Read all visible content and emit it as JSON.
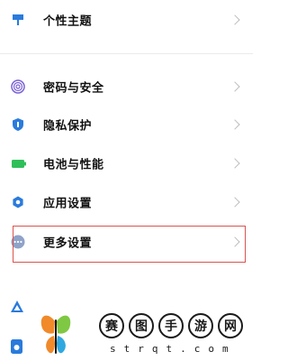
{
  "settings": {
    "items": [
      {
        "label": "个性主题",
        "icon": "palette-icon",
        "color": "#2a7bdc"
      },
      {
        "label": "密码与安全",
        "icon": "fingerprint-icon",
        "color": "#7b61d6"
      },
      {
        "label": "隐私保护",
        "icon": "shield-icon",
        "color": "#2a7bdc"
      },
      {
        "label": "电池与性能",
        "icon": "battery-icon",
        "color": "#2fbf5a"
      },
      {
        "label": "应用设置",
        "icon": "gear-icon",
        "color": "#2a7bdc"
      },
      {
        "label": "更多设置",
        "icon": "more-dots-icon",
        "color": "#8fa2c8"
      }
    ]
  },
  "highlight_color": "#d9534f",
  "watermark": {
    "chars": [
      "赛",
      "图",
      "手",
      "游",
      "网"
    ],
    "latin": "strqt.com",
    "logo_colors": [
      "#f08a2a",
      "#7fc843",
      "#2fa8e0"
    ]
  }
}
